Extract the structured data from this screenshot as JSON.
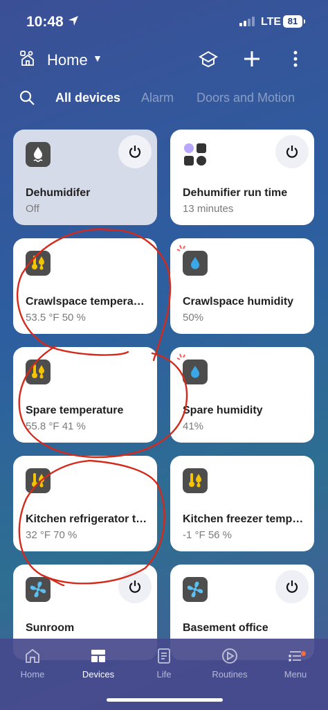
{
  "status_bar": {
    "time": "10:48",
    "network": "LTE",
    "battery": "81"
  },
  "header": {
    "title": "Home"
  },
  "tabs": [
    {
      "label": "All devices"
    },
    {
      "label": "Alarm"
    },
    {
      "label": "Doors and Motion"
    }
  ],
  "devices": [
    {
      "name": "Dehumidifer",
      "status": "Off",
      "icon": "dehumidifier-icon",
      "power": true
    },
    {
      "name": "Dehumifier run time",
      "status": "13 minutes",
      "icon": "shapes-icon",
      "power": true
    },
    {
      "name": "Crawlspace temperature",
      "status": "53.5 °F  50 %",
      "icon": "thermo-humidity-icon"
    },
    {
      "name": "Crawlspace humidity",
      "status": "50%",
      "icon": "water-drop-icon"
    },
    {
      "name": "Spare temperature",
      "status": "55.8 °F  41 %",
      "icon": "thermo-humidity-icon"
    },
    {
      "name": "Spare humidity",
      "status": "41%",
      "icon": "water-drop-icon"
    },
    {
      "name": "Kitchen refrigerator temperature",
      "status": "32 °F  70 %",
      "icon": "thermo-humidity-icon"
    },
    {
      "name": "Kitchen freezer temperature",
      "status": "-1 °F  56 %",
      "icon": "thermo-humidity-icon"
    },
    {
      "name": "Sunroom",
      "status": "",
      "icon": "fan-icon",
      "power": true
    },
    {
      "name": "Basement office",
      "status": "",
      "icon": "fan-icon",
      "power": true
    }
  ],
  "bottom_nav": [
    {
      "label": "Home"
    },
    {
      "label": "Devices"
    },
    {
      "label": "Life"
    },
    {
      "label": "Routines"
    },
    {
      "label": "Menu"
    }
  ],
  "colors": {
    "accent_red": "#d42a1c",
    "nav_active": "#ffffff",
    "menu_badge": "#ff6a3d"
  }
}
